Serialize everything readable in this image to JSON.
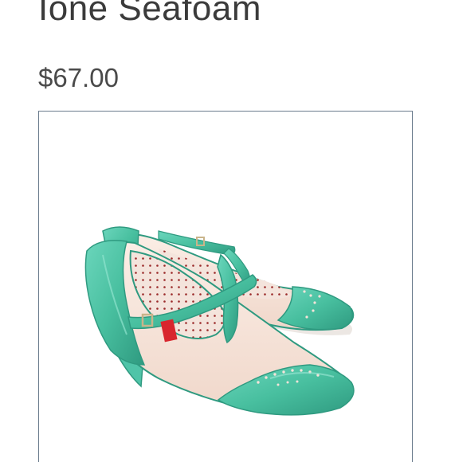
{
  "product": {
    "title": "Ione Seafoam",
    "price": "$67.00",
    "image": {
      "icon": "product-photo",
      "colors": {
        "patent_seafoam": "#4fc4a8",
        "seafoam_dark": "#2f9a80",
        "cream": "#f6e3d9",
        "lining_dot": "#9b2a2a",
        "label_red": "#d8262e",
        "buckle": "#c9b48a"
      }
    }
  }
}
